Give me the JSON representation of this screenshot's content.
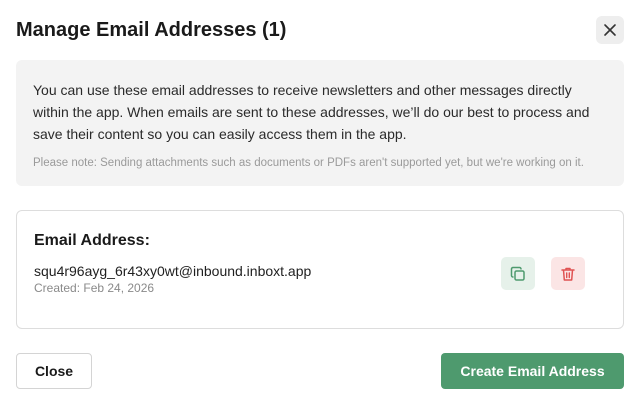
{
  "dialog": {
    "title": "Manage Email Addresses (1)"
  },
  "info": {
    "text": "You can use these email addresses to receive newsletters and other messages directly within the app. When emails are sent to these addresses, we’ll do our best to process and save their content so you can easily access them in the app.",
    "note": "Please note: Sending attachments such as documents or PDFs aren't supported yet, but we're working on it."
  },
  "address": {
    "heading": "Email Address:",
    "value": "squ4r96ayg_6r43xy0wt@inbound.inboxt.app",
    "created": "Created: Feb 24, 2026",
    "copy_icon": "copy-icon",
    "delete_icon": "trash-icon"
  },
  "footer": {
    "close_label": "Close",
    "create_label": "Create Email Address"
  },
  "colors": {
    "primary": "#4e9a6e",
    "copy_bg": "#e6f1ea",
    "copy_icon": "#4e9a6e",
    "delete_bg": "#fbe5e5",
    "delete_icon": "#e05252"
  }
}
